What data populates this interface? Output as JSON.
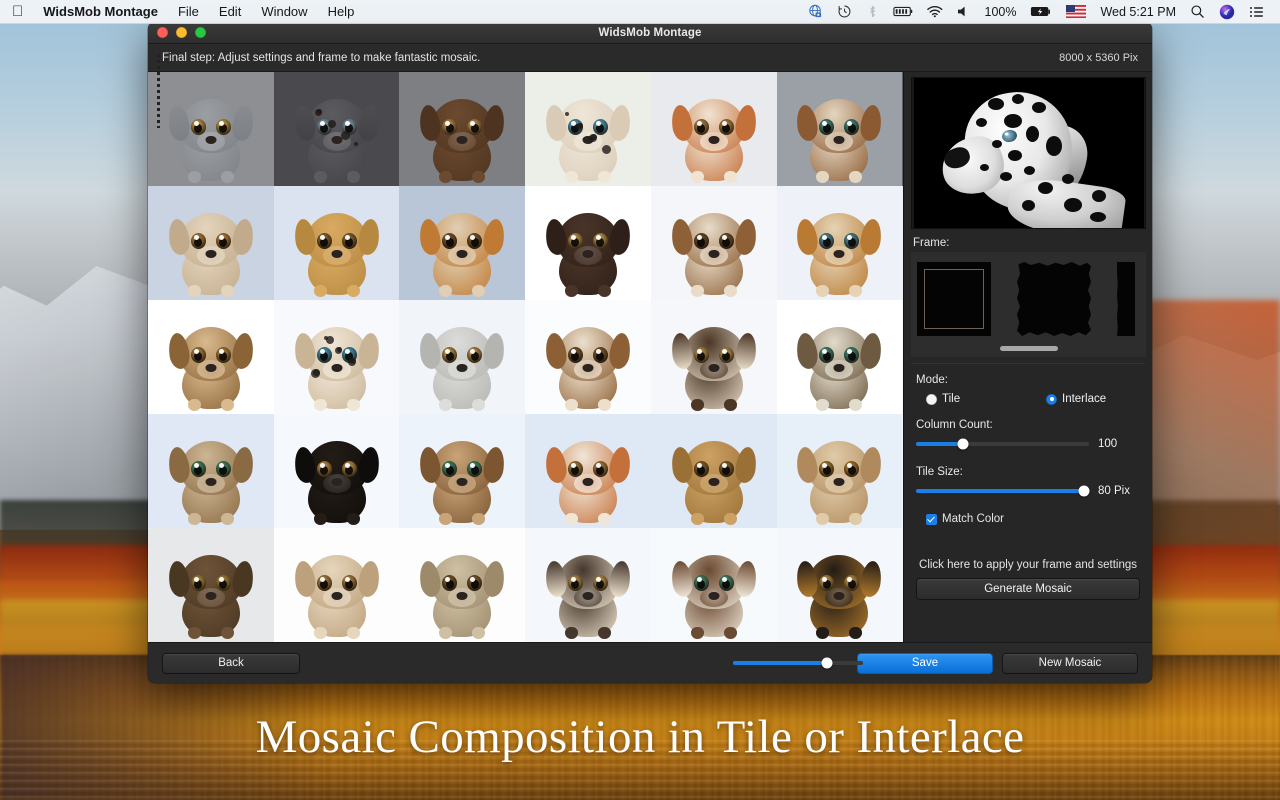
{
  "menubar": {
    "apple_logo": "apple-logo",
    "left_items": [
      {
        "label": "WidsMob Montage",
        "bold": true
      },
      {
        "label": "File",
        "bold": false
      },
      {
        "label": "Edit",
        "bold": false
      },
      {
        "label": "Window",
        "bold": false
      },
      {
        "label": "Help",
        "bold": false
      }
    ],
    "status_icons": [
      "globe-vpn-icon",
      "time-machine-icon",
      "bluetooth-icon",
      "battery-bar-icon",
      "wifi-icon",
      "volume-icon"
    ],
    "battery_percent": "100%",
    "flag_icon": "us-flag-icon",
    "clock": "Wed 5:21 PM",
    "right_icons": [
      "search-icon",
      "siri-icon",
      "control-center-icon"
    ]
  },
  "window": {
    "title": "WidsMob Montage",
    "step_text": "Final step: Adjust settings and frame to make fantastic mosaic.",
    "dimensions": "8000 x 5360 Pix"
  },
  "preview": {
    "alt": "dalmatian-portrait-preview"
  },
  "frame": {
    "label": "Frame:",
    "options": [
      "classic-square-frame",
      "rough-edge-frame",
      "partial-frame"
    ]
  },
  "settings": {
    "mode_label": "Mode:",
    "mode_options": [
      {
        "label": "Tile",
        "selected": false
      },
      {
        "label": "Interlace",
        "selected": true
      }
    ],
    "column_count_label": "Column Count:",
    "column_count_value": "100",
    "column_count_percent": 27,
    "tile_size_label": "Tile Size:",
    "tile_size_value": "80 Pix",
    "tile_size_percent": 97,
    "match_color_label": "Match Color",
    "match_color_checked": true,
    "apply_hint": "Click here to apply your frame and settings",
    "generate_label": "Generate Mosaic"
  },
  "bottombar": {
    "back_label": "Back",
    "zoom_percent": 72,
    "save_label": "Save",
    "new_mosaic_label": "New Mosaic"
  },
  "caption": {
    "text": "Mosaic Composition in Tile or Interlace"
  },
  "colors": {
    "accent": "#1b7fe8",
    "save_button": "#0a6fd8",
    "panel_bg": "#262626",
    "window_bg": "#232323"
  },
  "mosaic": {
    "tiles": [
      {
        "bg": "#8e8f93",
        "coat": "#9b9ea2",
        "coat2": "#7d8186",
        "eye": "#caa24a",
        "ear": "#888b90",
        "spots": 0
      },
      {
        "bg": "#4a4a4e",
        "coat": "#5c5c60",
        "coat2": "#434347",
        "eye": "#7fa8c0",
        "ear": "#4e4e52",
        "spots": 5
      },
      {
        "bg": "#7e7f83",
        "coat": "#6b4a2f",
        "coat2": "#4e3420",
        "eye": "#c79a4e",
        "ear": "#4e3420",
        "spots": 0
      },
      {
        "bg": "#eceee8",
        "coat": "#efe6d8",
        "coat2": "#d9cbb6",
        "eye": "#4fa8c8",
        "ear": "#d9cbb6",
        "spots": 6
      },
      {
        "bg": "#e8eaee",
        "coat": "#f0e3d2",
        "coat2": "#c4703a",
        "eye": "#b88a46",
        "ear": "#c4703a",
        "spots": 0
      },
      {
        "bg": "#9aa0a6",
        "coat": "#e4d6c0",
        "coat2": "#8c5a32",
        "eye": "#3f8f86",
        "ear": "#8c5a32",
        "spots": 0
      },
      {
        "bg": "#5f6368",
        "coat": "#d8c6ad",
        "coat2": "#6d4a2c",
        "eye": "#4f98b4",
        "ear": "#6d4a2c",
        "spots": 0
      },
      {
        "bg": "#c9d3e2",
        "coat": "#e3d4bb",
        "coat2": "#c2ab8c",
        "eye": "#b9873f",
        "ear": "#c2ab8c",
        "spots": 0
      },
      {
        "bg": "#dbe3f0",
        "coat": "#d9aa62",
        "coat2": "#b78840",
        "eye": "#8c6a34",
        "ear": "#b78840",
        "spots": 0
      },
      {
        "bg": "#b9c6d8",
        "coat": "#e0cfb4",
        "coat2": "#c07a33",
        "eye": "#7a5c2c",
        "ear": "#c07a33",
        "spots": 0
      },
      {
        "bg": "#ffffff",
        "coat": "#4a3428",
        "coat2": "#2e2018",
        "eye": "#caa150",
        "ear": "#2e2018",
        "spots": 0
      },
      {
        "bg": "#f4f6fa",
        "coat": "#e8dcc8",
        "coat2": "#8d6038",
        "eye": "#6f5228",
        "ear": "#8d6038",
        "spots": 0
      },
      {
        "bg": "#eef2f8",
        "coat": "#e5d3b4",
        "coat2": "#b97a34",
        "eye": "#4c93a8",
        "ear": "#b97a34",
        "spots": 0
      },
      {
        "bg": "#e5ecf6",
        "coat": "#f1e6d6",
        "coat2": "#d6c3a6",
        "eye": "#3fa0c4",
        "ear": "#d6c3a6",
        "spots": 7
      },
      {
        "bg": "#ffffff",
        "coat": "#d9b98e",
        "coat2": "#8a6436",
        "eye": "#b4863c",
        "ear": "#8a6436",
        "spots": 0
      },
      {
        "bg": "#f7f9fc",
        "coat": "#f0e6d6",
        "coat2": "#c9b596",
        "eye": "#3e9fc6",
        "ear": "#c9b596",
        "spots": 8
      },
      {
        "bg": "#f1f4f8",
        "coat": "#dcdcda",
        "coat2": "#b4b4b0",
        "eye": "#c79a48",
        "ear": "#b4b4b0",
        "spots": 0
      },
      {
        "bg": "#fbfcfe",
        "coat": "#ece0cc",
        "coat2": "#8d5f34",
        "eye": "#7d5c2e",
        "ear": "#8d5f34",
        "spots": 0
      },
      {
        "bg": "#f5f7fa",
        "coat": "#4c3626",
        "coat2": "#e6dac6",
        "eye": "#c39b4c",
        "ear": "#4c3626",
        "spots": 0
      },
      {
        "bg": "#ffffff",
        "coat": "#e2dccc",
        "coat2": "#6e5a40",
        "eye": "#3f8f7c",
        "ear": "#6e5a40",
        "spots": 0
      },
      {
        "bg": "#f2f5fa",
        "coat": "#b97a3a",
        "coat2": "#7e4f22",
        "eye": "#3f7f8e",
        "ear": "#7e4f22",
        "spots": 0
      },
      {
        "bg": "#dfe8f4",
        "coat": "#cdb694",
        "coat2": "#8a6a42",
        "eye": "#3f8f6e",
        "ear": "#8a6a42",
        "spots": 0
      },
      {
        "bg": "#f5f8fc",
        "coat": "#241c16",
        "coat2": "#0f0d0b",
        "eye": "#c89a4a",
        "ear": "#0f0d0b",
        "spots": 0
      },
      {
        "bg": "#edf3fb",
        "coat": "#c9a478",
        "coat2": "#7b5630",
        "eye": "#3f8f74",
        "ear": "#7b5630",
        "spots": 0
      },
      {
        "bg": "#dfe9f6",
        "coat": "#f0e6d8",
        "coat2": "#c4703a",
        "eye": "#b0863e",
        "ear": "#c4703a",
        "spots": 0
      },
      {
        "bg": "#dfe9f6",
        "coat": "#cda163",
        "coat2": "#9a7036",
        "eye": "#8a6630",
        "ear": "#9a7036",
        "spots": 0
      },
      {
        "bg": "#e7eff9",
        "coat": "#e0cba8",
        "coat2": "#b08a5c",
        "eye": "#b08432",
        "ear": "#b08a5c",
        "spots": 0
      },
      {
        "bg": "#f4f7fb",
        "coat": "#3c2a1e",
        "coat2": "#1d1410",
        "eye": "#c79a4c",
        "ear": "#1d1410",
        "spots": 0
      },
      {
        "bg": "#e6e8ea",
        "coat": "#6e5338",
        "coat2": "#4a3722",
        "eye": "#b8923e",
        "ear": "#4a3722",
        "spots": 0
      },
      {
        "bg": "#fdfdfd",
        "coat": "#e6d6bc",
        "coat2": "#bda07c",
        "eye": "#b98c40",
        "ear": "#bda07c",
        "spots": 0
      },
      {
        "bg": "#fdfdfd",
        "coat": "#cfc0a4",
        "coat2": "#9c8a6a",
        "eye": "#7c5c2c",
        "ear": "#9c8a6a",
        "spots": 0
      },
      {
        "bg": "#f4f7fb",
        "coat": "#45372c",
        "coat2": "#ece0cc",
        "eye": "#c59a4e",
        "ear": "#45372c",
        "spots": 0
      },
      {
        "bg": "#f7fafd",
        "coat": "#6b4a32",
        "coat2": "#efe6d6",
        "eye": "#3f8f6e",
        "ear": "#6b4a32",
        "spots": 0
      },
      {
        "bg": "#f4f7fb",
        "coat": "#241c16",
        "coat2": "#b07a2c",
        "eye": "#c79a4a",
        "ear": "#241c16",
        "spots": 0
      },
      {
        "bg": "#f2f5f9",
        "coat": "#2b2018",
        "coat2": "#a8762e",
        "eye": "#c49a4c",
        "ear": "#2b2018",
        "spots": 0
      }
    ]
  }
}
